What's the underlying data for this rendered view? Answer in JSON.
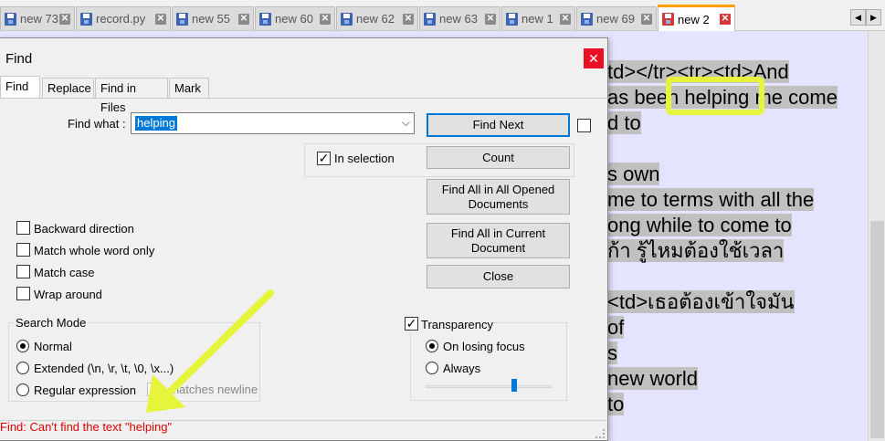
{
  "tabs": [
    {
      "label": "new 73",
      "icon": "file-icon"
    },
    {
      "label": "record.py",
      "icon": "file-icon"
    },
    {
      "label": "new 55",
      "icon": "file-icon"
    },
    {
      "label": "new 60",
      "icon": "file-icon"
    },
    {
      "label": "new 62",
      "icon": "file-icon"
    },
    {
      "label": "new 63",
      "icon": "file-icon"
    },
    {
      "label": "new 1",
      "icon": "file-icon"
    },
    {
      "label": "new 69",
      "icon": "file-icon"
    },
    {
      "label": "new 2",
      "icon": "file-icon-red",
      "active": true
    }
  ],
  "editor": {
    "lines": [
      {
        "text": "td></tr><tr><td>And"
      },
      {
        "text": "as been helping me come"
      },
      {
        "text": "d to"
      },
      {
        "text": ""
      },
      {
        "text": "s own"
      },
      {
        "text": "me to terms with all the"
      },
      {
        "text": "ong while to come to"
      },
      {
        "text": "ก้า รู้ไหมต้องใช้เวลา"
      },
      {
        "text": ""
      },
      {
        "text": "<td>เธอต้องเข้าใจมัน"
      },
      {
        "text": "of"
      },
      {
        "text": "s"
      },
      {
        "text": "new world"
      },
      {
        "text": "to"
      }
    ],
    "highlight_color": "#e6f53b"
  },
  "dialog": {
    "title": "Find",
    "close_glyph": "✕",
    "tabs": [
      "Find",
      "Replace",
      "Find in Files",
      "Mark"
    ],
    "find_what_label": "Find what :",
    "find_what_value": "helping",
    "dropdown_glyph": "⌵",
    "in_selection_label": "In selection",
    "in_selection_checked": true,
    "buttons": {
      "find_next": "Find Next",
      "count": "Count",
      "find_all_opened_line1": "Find All in All Opened",
      "find_all_opened_line2": "Documents",
      "find_all_current_line1": "Find All in Current",
      "find_all_current_line2": "Document",
      "close": "Close"
    },
    "options": [
      {
        "label": "Backward direction",
        "checked": false
      },
      {
        "label": "Match whole word only",
        "checked": false
      },
      {
        "label": "Match case",
        "checked": false
      },
      {
        "label": "Wrap around",
        "checked": false
      }
    ],
    "search_mode": {
      "legend": "Search Mode",
      "normal": "Normal",
      "extended": "Extended (\\n, \\r, \\t, \\0, \\x...)",
      "regex": "Regular expression",
      "matches_newline": ". matches newline",
      "selected": "Normal"
    },
    "transparency": {
      "legend": "Transparency",
      "checked": true,
      "on_losing_focus": "On losing focus",
      "always": "Always",
      "selected": "On losing focus",
      "level": 0.68
    },
    "status": "Find: Can't find the text \"helping\"",
    "status_color": "#e00000"
  },
  "annotation": {
    "arrow_color": "#e6f53b"
  }
}
